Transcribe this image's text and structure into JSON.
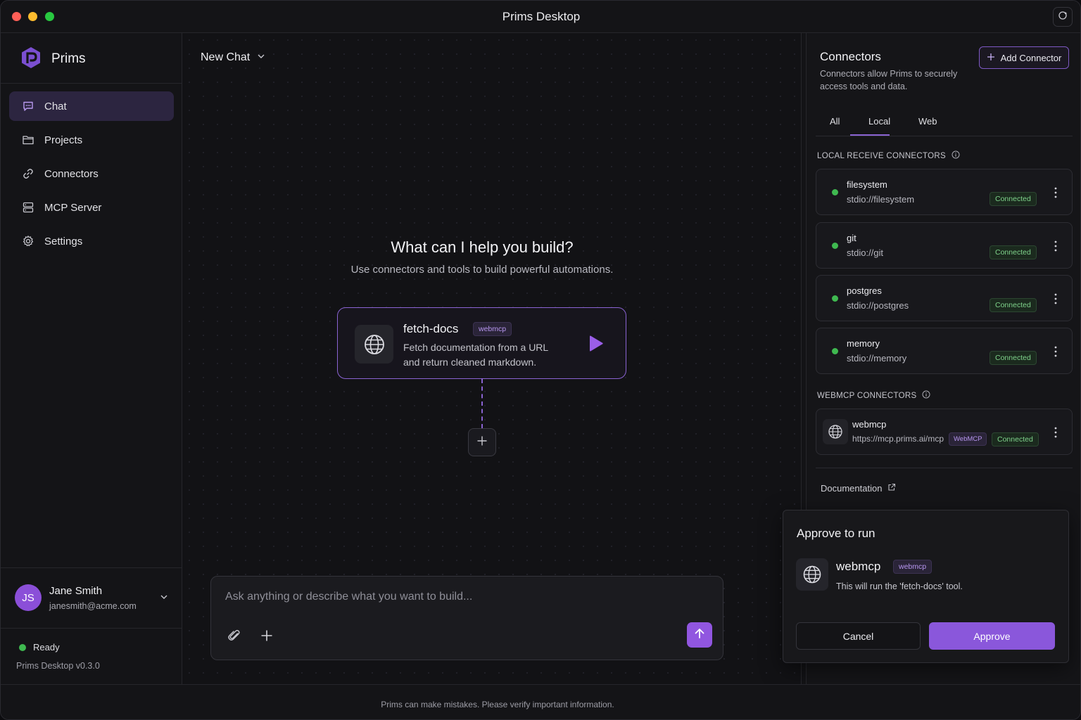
{
  "window": {
    "title": "Prims Desktop"
  },
  "sidebar": {
    "brand": "Prims",
    "items": [
      {
        "label": "Chat",
        "icon": "chat-bubble-icon",
        "active": true
      },
      {
        "label": "Projects",
        "icon": "folder-icon",
        "active": false
      },
      {
        "label": "Connectors",
        "icon": "link-icon",
        "active": false
      },
      {
        "label": "MCP Server",
        "icon": "server-icon",
        "active": false
      },
      {
        "label": "Settings",
        "icon": "gear-icon",
        "active": false
      }
    ],
    "user": {
      "initials": "JS",
      "name": "Jane Smith",
      "email": "janesmith@acme.com"
    },
    "status": "Ready",
    "version": "Prims Desktop v0.3.0"
  },
  "main": {
    "chat_title": "New Chat",
    "hero_title": "What can I help you build?",
    "hero_subtitle": "Use connectors and tools to build powerful automations.",
    "tool": {
      "name": "fetch-docs",
      "badge": "webmcp",
      "description": "Fetch documentation from a URL and return cleaned markdown."
    },
    "input": {
      "placeholder": "Ask anything or describe what you want to build..."
    }
  },
  "connectors": {
    "title": "Connectors",
    "description": "Connectors allow Prims to securely access tools and data.",
    "add_label": "Add Connector",
    "tabs": [
      "All",
      "Local",
      "Web"
    ],
    "active_tab": "Local",
    "local_section": "LOCAL RECEIVE CONNECTORS",
    "local": [
      {
        "name": "filesystem",
        "uri": "stdio://filesystem",
        "status": "Connected"
      },
      {
        "name": "git",
        "uri": "stdio://git",
        "status": "Connected"
      },
      {
        "name": "postgres",
        "uri": "stdio://postgres",
        "status": "Connected"
      },
      {
        "name": "memory",
        "uri": "stdio://memory",
        "status": "Connected"
      }
    ],
    "web_section": "WEBMCP CONNECTORS",
    "web": [
      {
        "name": "webmcp",
        "uri": "https://mcp.prims.ai/mcp",
        "type": "WebMCP",
        "status": "Connected"
      }
    ],
    "doc_link": "Documentation"
  },
  "approve": {
    "title": "Approve to run",
    "name": "webmcp",
    "badge": "webmcp",
    "description": "This will run the 'fetch-docs' tool.",
    "cancel": "Cancel",
    "confirm": "Approve"
  },
  "footer": {
    "text": "Prims can make mistakes. Please verify important information."
  },
  "colors": {
    "accent": "#8a57db",
    "connected": "#3fb950"
  }
}
